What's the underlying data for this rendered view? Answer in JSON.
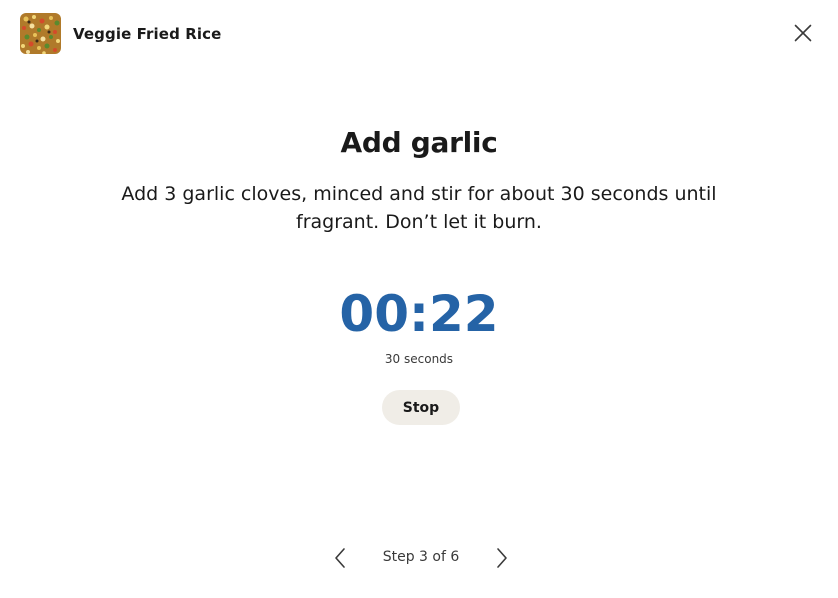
{
  "header": {
    "recipe_title": "Veggie Fried Rice",
    "thumbnail_icon": "fried-rice-thumbnail",
    "close_icon": "close-icon"
  },
  "step": {
    "title": "Add garlic",
    "description": "Add 3 garlic cloves, minced and stir for about 30 seconds until fragrant. Don’t let it burn."
  },
  "timer": {
    "remaining": "00:22",
    "duration_label": "30 seconds",
    "stop_label": "Stop",
    "color": "#2563a6"
  },
  "navigation": {
    "counter": "Step 3 of 6",
    "prev_icon": "chevron-left-icon",
    "next_icon": "chevron-right-icon"
  }
}
